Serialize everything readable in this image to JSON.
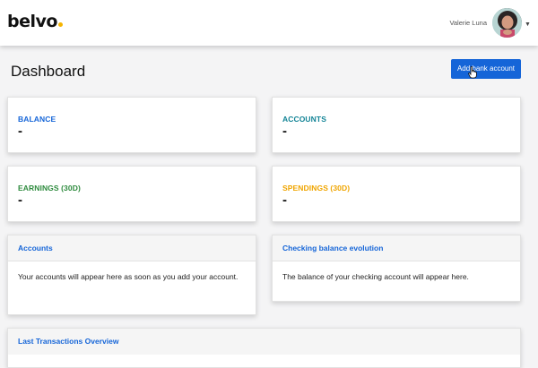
{
  "colors": {
    "primary": "#1565d8",
    "teal": "#138496",
    "green": "#2e8b3e",
    "orange": "#f0a500",
    "logo_dot": "#f5b400"
  },
  "header": {
    "logo_text": "belvo",
    "user_name": "Valerie Luna",
    "avatar_icon": "user-avatar-photo",
    "dropdown_icon": "caret-down-icon"
  },
  "page": {
    "title": "Dashboard",
    "add_button_label": "Add bank account"
  },
  "stats": {
    "balance": {
      "label": "BALANCE",
      "value": "-"
    },
    "accounts": {
      "label": "ACCOUNTS",
      "value": "-"
    },
    "earnings": {
      "label": "EARNINGS (30D)",
      "value": "-"
    },
    "spendings": {
      "label": "SPENDINGS (30D)",
      "value": "-"
    }
  },
  "panels": {
    "accounts": {
      "title": "Accounts",
      "body": "Your accounts will appear here as soon as you add your account."
    },
    "checking": {
      "title": "Checking balance evolution",
      "body": "The balance of your checking account will appear here."
    },
    "transactions": {
      "title": "Last Transactions Overview"
    }
  }
}
